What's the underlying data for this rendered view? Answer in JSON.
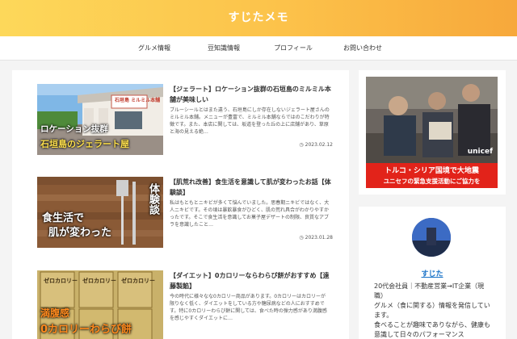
{
  "site": {
    "title": "すじたメモ"
  },
  "nav": [
    "グルメ情報",
    "豆知識情報",
    "プロフィール",
    "お問い合わせ"
  ],
  "posts": [
    {
      "title": "【ジェラート】ロケーション抜群の石垣島のミルミル本舗が美味しい",
      "excerpt": "ブルーシールとはまた違う、石垣島にしか存在しないジェラート屋さんのミルミル本舗。メニューが豊富で、ミルミル本舗ならではのこだわりが特徴です。また、本店に関しては、坂道を登った丘の上に店舗があり、草原と海の見える絶…",
      "date": "2023.02.12",
      "thumb_sign": "石垣島 ミルミル本舗",
      "thumb_line1": "ロケーション抜群",
      "thumb_line2": "石垣島のジェラート屋"
    },
    {
      "title": "【肌荒れ改善】食生活を意識して肌が変わったお話【体験談】",
      "excerpt": "私はもともとニキビが多くて悩んでいました。思春期ニキビではなく、大人ニキビです。その頃は暴飲暴食がひどく、肌の荒れ具合がわかりやすかったです。そこで食生活を意識してお菓子屋デザートの制限、良質なアブラを意識したこと…",
      "date": "2023.01.28",
      "thumb_side": "体験談",
      "thumb_line1": "食生活で",
      "thumb_line2": "肌が変わった"
    },
    {
      "title": "【ダイエット】0カロリーならわらび餅がおすすめ【遠藤製餡】",
      "excerpt": "今の時代に様々なな0カロリー商品があります。0カロリーはカロリーが限りなく低く、ダイエットをしている方や糖尿病などの人におすすめです。特に0カロリーわらび餅に関しては、食べた時の弾力感があり満腹感を感じやすくダイエットに…",
      "thumb_pack": "ゼロカロリー",
      "thumb_line1": "満腹感",
      "thumb_line2": "0カロリーわらび餅"
    }
  ],
  "ad": {
    "brand": "unicef",
    "line1": "トルコ・シリア国境で大地震",
    "line2": "ユニセフの緊急支援活動にご協力を"
  },
  "profile": {
    "name": "すじた",
    "bio": "20代会社員｜不動産営業→IT企業（現職）\nグルメ（食に関する）情報を発信しています。\n食べることが趣味でありながら、健康も意識して日々のパフォーマンス"
  },
  "colors": {
    "header_start": "#fdd85a",
    "header_end": "#f7a83b",
    "accent_link": "#1a73c8",
    "ad_red": "#e2231a"
  }
}
